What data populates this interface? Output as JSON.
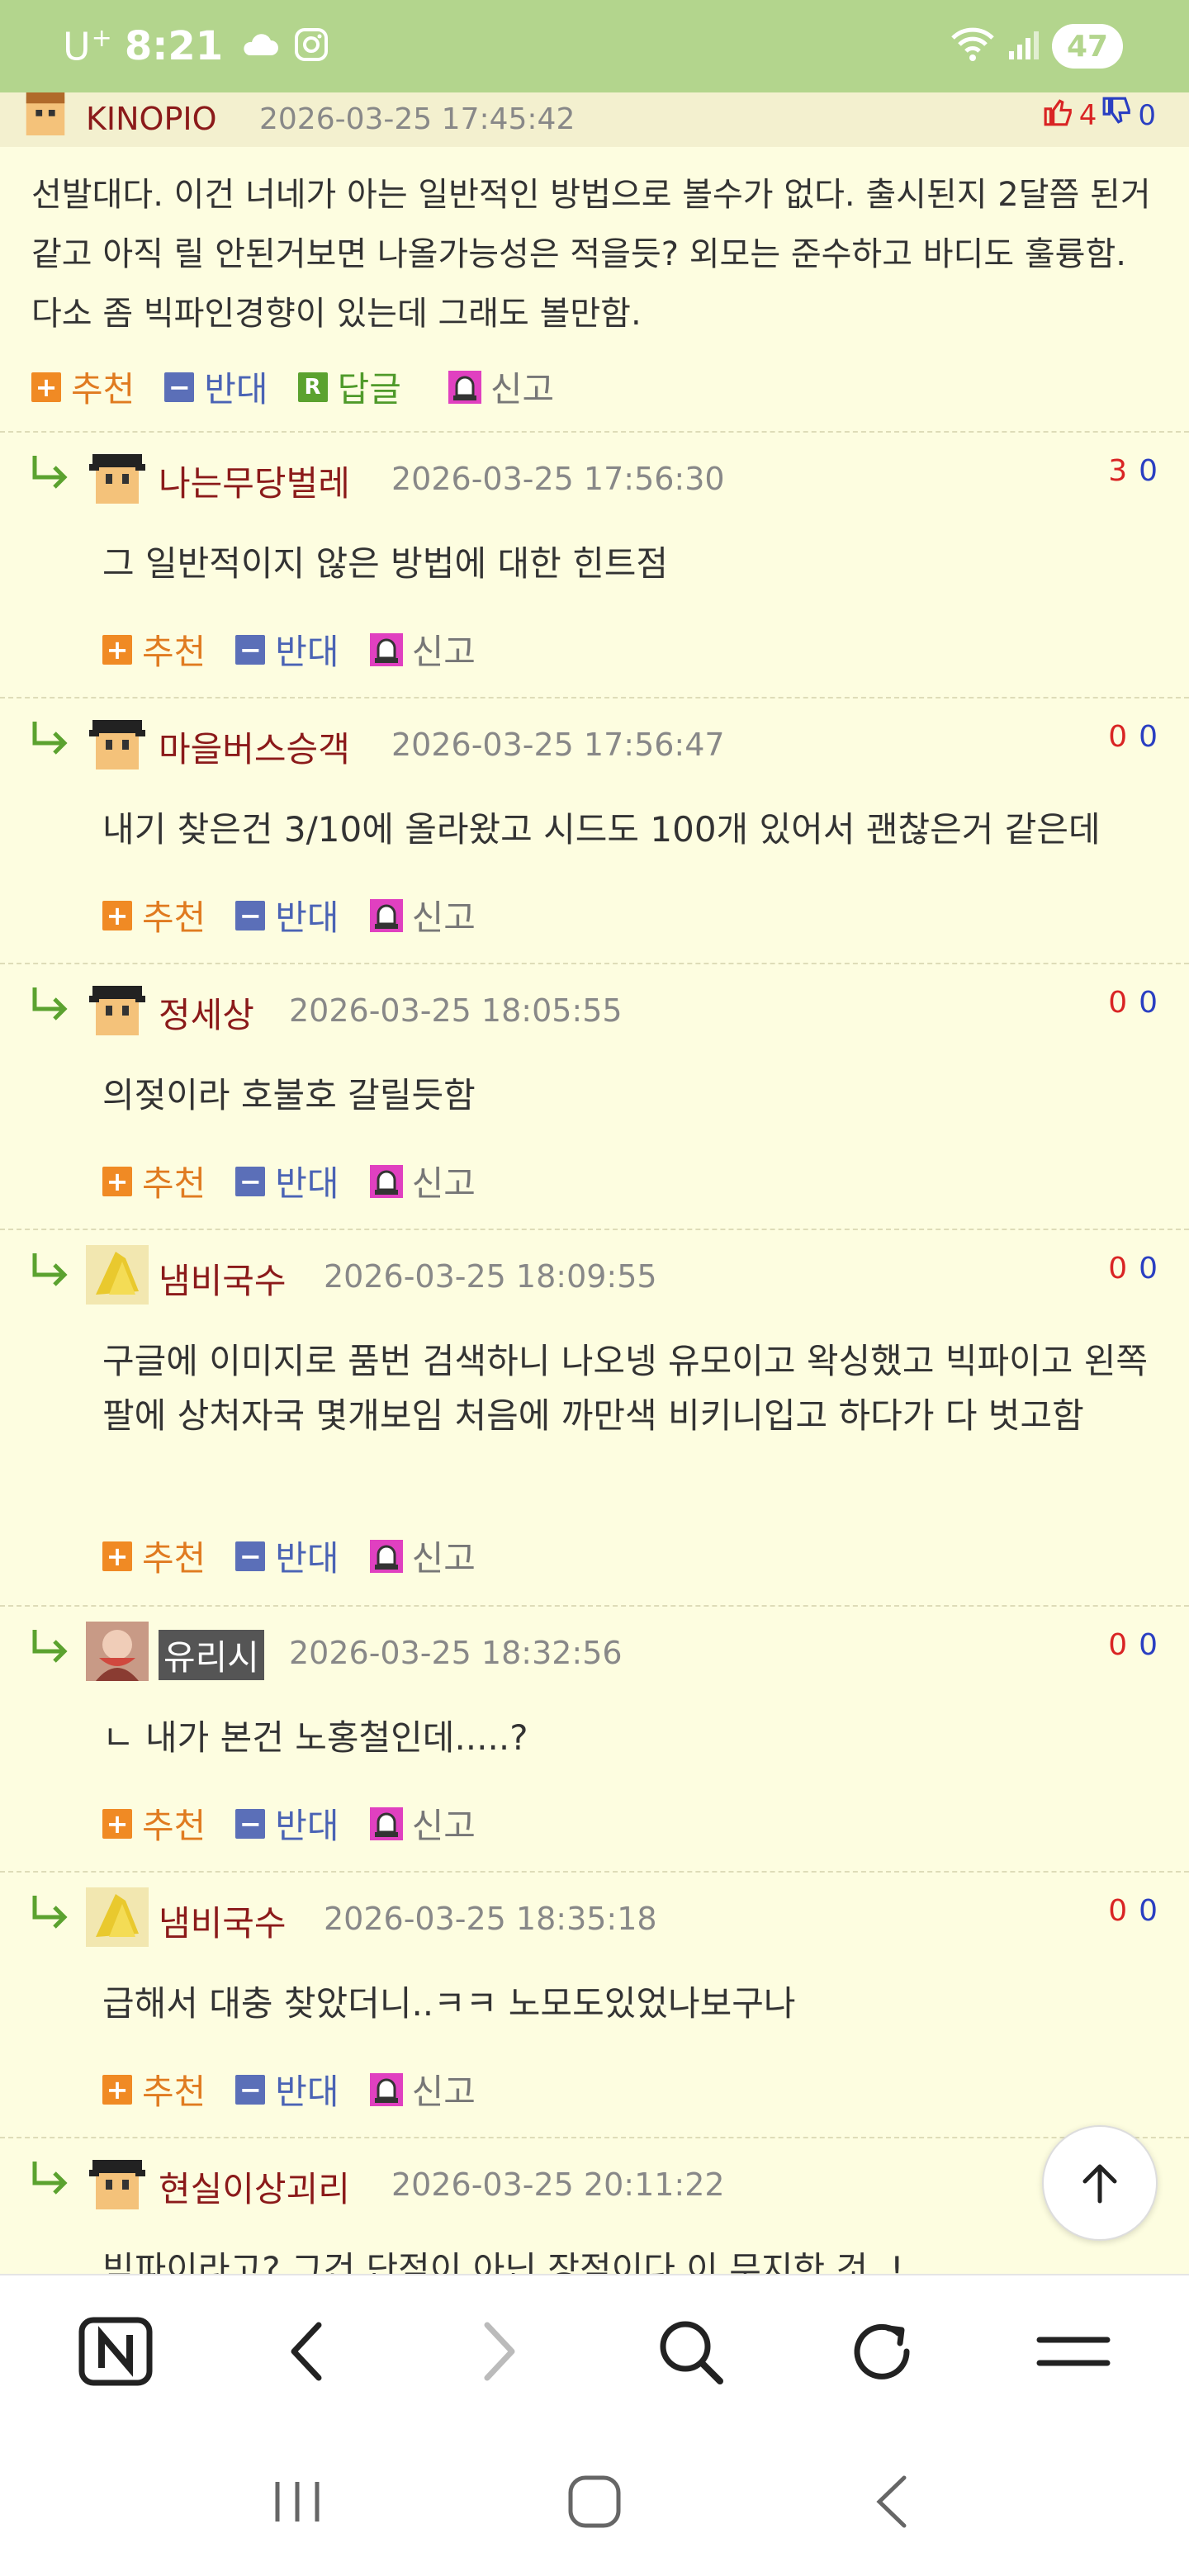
{
  "status": {
    "carrier": "U",
    "carrier_plus": "+",
    "time": "8:21",
    "battery": "47"
  },
  "parent": {
    "nick": "KINOPIO",
    "date": "2026-03-25 17:45:42",
    "up": "4",
    "down": "0",
    "body": "선발대다. 이건 너네가 아는 일반적인 방법으로 볼수가 없다. 출시된지 2달쯤 된거 같고 아직 릴 안된거보면 나올가능성은 적을듯? 외모는 준수하고 바디도 훌륭함. 다소 좀 빅파인경향이 있는데 그래도 볼만함.",
    "actions": {
      "recommend": "추천",
      "oppose": "반대",
      "reply_box": "R",
      "reply": "답글",
      "report": "신고"
    }
  },
  "action_labels": {
    "recommend": "추천",
    "oppose": "반대",
    "report": "신고",
    "plus": "+",
    "minus": "−"
  },
  "replies": [
    {
      "nick": "나는무당벌레",
      "date": "2026-03-25 17:56:30",
      "up": "3",
      "down": "0",
      "text": "그 일반적이지 않은 방법에 대한 힌트점"
    },
    {
      "nick": "마을버스승객",
      "date": "2026-03-25 17:56:47",
      "up": "0",
      "down": "0",
      "text": "내기 찾은건 3/10에 올라왔고 시드도 100개 있어서 괜찮은거 같은데"
    },
    {
      "nick": "정세상",
      "date": "2026-03-25 18:05:55",
      "up": "0",
      "down": "0",
      "text": "의젖이라 호불호 갈릴듯함"
    },
    {
      "nick": "냄비국수",
      "date": "2026-03-25 18:09:55",
      "up": "0",
      "down": "0",
      "text": "구글에 이미지로 품번 검색하니 나오넹 유모이고 왁싱했고 빅파이고 왼쪽 팔에 상처자국 몇개보임 처음에 까만색 비키니입고 하다가 다 벗고함"
    },
    {
      "nick": "유리시",
      "date": "2026-03-25 18:32:56",
      "up": "0",
      "down": "0",
      "text": "ㄴ 내가 본건 노홍철인데.....?"
    },
    {
      "nick": "냄비국수",
      "date": "2026-03-25 18:35:18",
      "up": "0",
      "down": "0",
      "text": "급해서 대충 찾았더니..ㅋㅋ 노모도있었나보구나"
    },
    {
      "nick": "현실이상괴리",
      "date": "2026-03-25 20:11:22",
      "up": "",
      "down": "",
      "text": "빅파이라고? 그건 단점이 아닌 장점이다 이 무지한 것..!"
    }
  ],
  "colors": {
    "status_bar": "#b3d58d",
    "page_bg": "#fdfde0",
    "nick": "#8b1a1a",
    "vote_up": "#d92424",
    "vote_down": "#2a3fc2"
  },
  "icons": [
    "cloud-icon",
    "instagram-icon",
    "wifi-icon",
    "signal-icon",
    "naver-icon",
    "back-icon",
    "forward-icon",
    "search-icon",
    "refresh-icon",
    "menu-icon",
    "recent-apps-icon",
    "home-icon",
    "nav-back-icon",
    "scroll-top-icon"
  ]
}
